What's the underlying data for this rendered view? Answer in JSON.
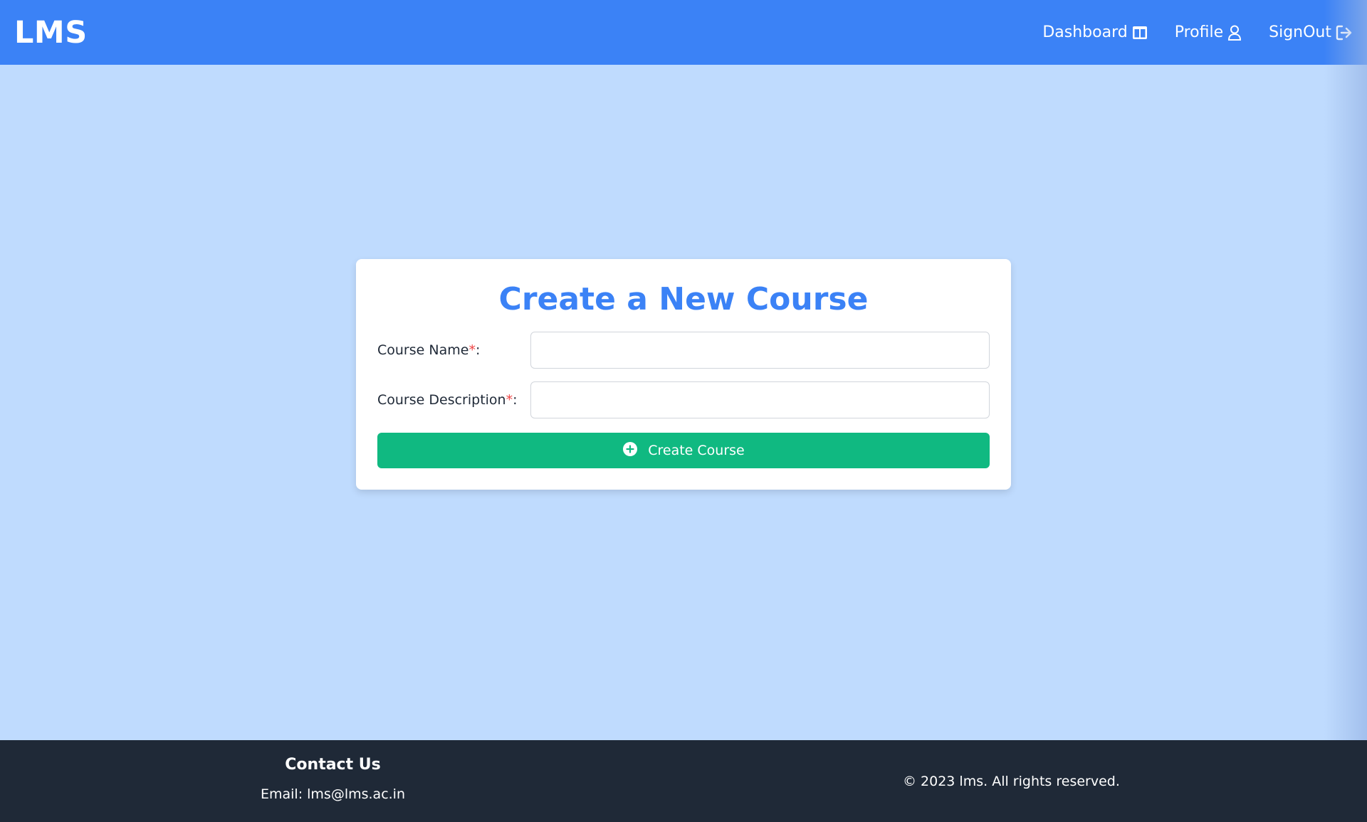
{
  "header": {
    "logo": "LMS",
    "nav": [
      {
        "label": "Dashboard",
        "icon": "dashboard-icon"
      },
      {
        "label": "Profile",
        "icon": "user-icon"
      },
      {
        "label": "SignOut",
        "icon": "sign-out-icon"
      }
    ]
  },
  "form": {
    "title": "Create a New Course",
    "fields": [
      {
        "label": "Course Name",
        "required_mark": "*",
        "suffix": ":",
        "value": "",
        "placeholder": ""
      },
      {
        "label": "Course Description",
        "required_mark": "*",
        "suffix": ":",
        "value": "",
        "placeholder": ""
      }
    ],
    "submit_label": "Create Course",
    "submit_icon": "plus-circle-icon"
  },
  "footer": {
    "contact_title": "Contact Us",
    "contact_email": "Email: lms@lms.ac.in",
    "copyright": "© 2023 lms. All rights reserved."
  },
  "colors": {
    "header_bg": "#3b82f6",
    "page_bg": "#bfdbfe",
    "title": "#3b82f6",
    "submit_bg": "#10b981",
    "required": "#ef4444",
    "footer_bg": "#1f2937"
  }
}
